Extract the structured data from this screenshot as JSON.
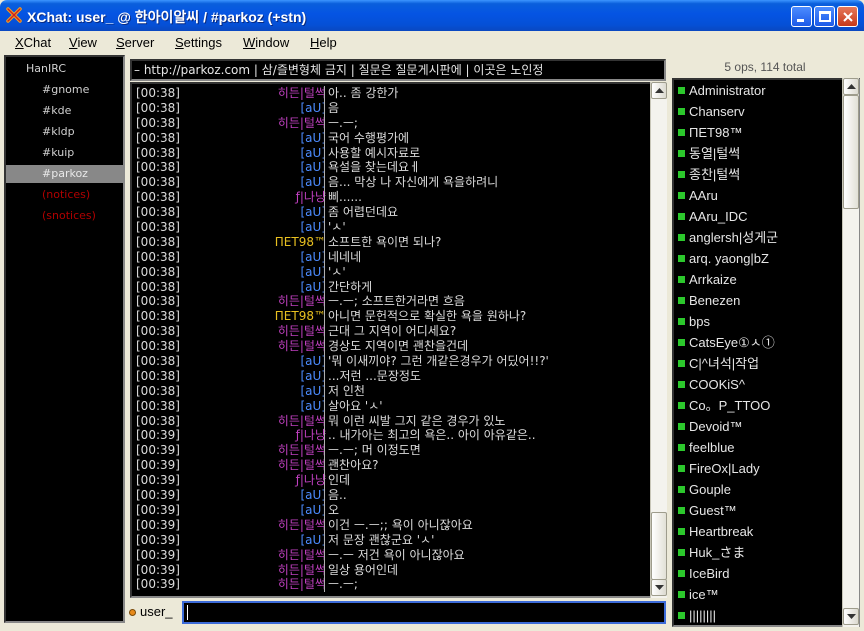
{
  "window": {
    "title": "XChat: user_ @ 한아이알씨 / #parkoz (+stn)"
  },
  "menu": [
    {
      "u": "X",
      "rest": "Chat"
    },
    {
      "u": "V",
      "rest": "iew"
    },
    {
      "u": "S",
      "rest": "erver"
    },
    {
      "u": "S",
      "rest": "ettings"
    },
    {
      "u": "W",
      "rest": "indow"
    },
    {
      "u": "H",
      "rest": "elp"
    }
  ],
  "tree": [
    {
      "label": "HanIRC",
      "type": "server"
    },
    {
      "label": "#gnome",
      "type": "channel"
    },
    {
      "label": "#kde",
      "type": "channel"
    },
    {
      "label": "#kldp",
      "type": "channel"
    },
    {
      "label": "#kuip",
      "type": "channel"
    },
    {
      "label": "#parkoz",
      "type": "selected"
    },
    {
      "label": "(notices)",
      "type": "notice"
    },
    {
      "label": "(snotices)",
      "type": "notice"
    }
  ],
  "topic": "– http://parkoz.com | 삼/즐변형체 금지 | 질문은 질문게시판에 | 이곳은 노인정",
  "colors": {
    "nick_hiden": "#c040c0",
    "nick_au": "#4c8cff",
    "nick_pet": "#e8c020",
    "nick_nayang": "#c040c0",
    "accent": "#0554e3"
  },
  "chat": [
    {
      "ts": "[00:38]",
      "nick": "히든|털썩",
      "color": "#c040c0",
      "msg": "아.. 좀 강한가"
    },
    {
      "ts": "[00:38]",
      "nick": "[aU]",
      "color": "#4c8cff",
      "msg": "음"
    },
    {
      "ts": "[00:38]",
      "nick": "히든|털썩",
      "color": "#c040c0",
      "msg": "ㅡ.ㅡ;"
    },
    {
      "ts": "[00:38]",
      "nick": "[aU]",
      "color": "#4c8cff",
      "msg": "국어 수행평가에"
    },
    {
      "ts": "[00:38]",
      "nick": "[aU]",
      "color": "#4c8cff",
      "msg": "사용할 예시자료로"
    },
    {
      "ts": "[00:38]",
      "nick": "[aU]",
      "color": "#4c8cff",
      "msg": "욕설을 찾는데요ㅔ"
    },
    {
      "ts": "[00:38]",
      "nick": "[aU]",
      "color": "#4c8cff",
      "msg": "음... 막상 나 자신에게 욕을하려니"
    },
    {
      "ts": "[00:38]",
      "nick": "ƒ|나냥",
      "color": "#c040c0",
      "msg": "삐......"
    },
    {
      "ts": "[00:38]",
      "nick": "[aU]",
      "color": "#4c8cff",
      "msg": "좀 어렵던데요"
    },
    {
      "ts": "[00:38]",
      "nick": "[aU]",
      "color": "#4c8cff",
      "msg": "'ㅅ'"
    },
    {
      "ts": "[00:38]",
      "nick": "ΠΕΤ98™",
      "color": "#e8c020",
      "msg": "소프트한 욕이면 되나?"
    },
    {
      "ts": "[00:38]",
      "nick": "[aU]",
      "color": "#4c8cff",
      "msg": "네네네"
    },
    {
      "ts": "[00:38]",
      "nick": "[aU]",
      "color": "#4c8cff",
      "msg": "'ㅅ'"
    },
    {
      "ts": "[00:38]",
      "nick": "[aU]",
      "color": "#4c8cff",
      "msg": "간단하게"
    },
    {
      "ts": "[00:38]",
      "nick": "히든|털썩",
      "color": "#c040c0",
      "msg": "ㅡ.ㅡ; 소프트한거라면 흐음"
    },
    {
      "ts": "[00:38]",
      "nick": "ΠΕΤ98™",
      "color": "#e8c020",
      "msg": "아니면 문헌적으로 확실한 욕을 원하나?"
    },
    {
      "ts": "[00:38]",
      "nick": "히든|털썩",
      "color": "#c040c0",
      "msg": "근대 그 지역이 어디세요?"
    },
    {
      "ts": "[00:38]",
      "nick": "히든|털썩",
      "color": "#c040c0",
      "msg": "경상도 지역이면 괜찬을건데"
    },
    {
      "ts": "[00:38]",
      "nick": "[aU]",
      "color": "#4c8cff",
      "msg": "'뭐 이새끼야? 그런 개같은경우가 어딨어!!?'"
    },
    {
      "ts": "[00:38]",
      "nick": "[aU]",
      "color": "#4c8cff",
      "msg": "...저런 ...문장정도"
    },
    {
      "ts": "[00:38]",
      "nick": "[aU]",
      "color": "#4c8cff",
      "msg": "저 인천"
    },
    {
      "ts": "[00:38]",
      "nick": "[aU]",
      "color": "#4c8cff",
      "msg": "살아요 'ㅅ'"
    },
    {
      "ts": "[00:38]",
      "nick": "히든|털썩",
      "color": "#c040c0",
      "msg": "뭐 이런 씨발 그지 같은 경우가 있노"
    },
    {
      "ts": "[00:39]",
      "nick": "ƒ|나냥",
      "color": "#c040c0",
      "msg": ".. 내가아는 최고의 욕은.. 아이 아유같은.."
    },
    {
      "ts": "[00:39]",
      "nick": "히든|털썩",
      "color": "#c040c0",
      "msg": "ㅡ.ㅡ; 머 이정도면"
    },
    {
      "ts": "[00:39]",
      "nick": "히든|털썩",
      "color": "#c040c0",
      "msg": "괜찬아요?"
    },
    {
      "ts": "[00:39]",
      "nick": "ƒ|나냥",
      "color": "#c040c0",
      "msg": "인데"
    },
    {
      "ts": "[00:39]",
      "nick": "[aU]",
      "color": "#4c8cff",
      "msg": "음.."
    },
    {
      "ts": "[00:39]",
      "nick": "[aU]",
      "color": "#4c8cff",
      "msg": "오"
    },
    {
      "ts": "[00:39]",
      "nick": "히든|털썩",
      "color": "#c040c0",
      "msg": "이건 ㅡ.ㅡ;; 욕이 아니잖아요"
    },
    {
      "ts": "[00:39]",
      "nick": "[aU]",
      "color": "#4c8cff",
      "msg": "저 문장 괜찮군요 'ㅅ'"
    },
    {
      "ts": "[00:39]",
      "nick": "히든|털썩",
      "color": "#c040c0",
      "msg": "ㅡ.ㅡ 저건 욕이 아니잖아요"
    },
    {
      "ts": "[00:39]",
      "nick": "히든|털썩",
      "color": "#c040c0",
      "msg": "일상 용어인데"
    },
    {
      "ts": "[00:39]",
      "nick": "히든|털썩",
      "color": "#c040c0",
      "msg": "ㅡ.ㅡ;"
    }
  ],
  "input": {
    "nick": "user_",
    "value": ""
  },
  "userlist": {
    "summary": "5 ops, 114 total",
    "users": [
      "Administrator",
      "Chanserv",
      "ΠΕΤ98™",
      "동열|털썩",
      "종찬|털썩",
      "AAru",
      "AAru_IDC",
      "anglersh|성게군",
      "arq. yaong|bZ",
      "Arrkaize",
      "Benezen",
      "bps",
      "CatsEye①ㅅ①",
      "C|^녀석|작업",
      "COOKiS^",
      "Co。P_TTOO",
      "Devoid™",
      "feelblue",
      "FireOx|Lady",
      "Gouple",
      "Guest™",
      "Heartbreak",
      "Huk_さま",
      "IceBird",
      "ice™",
      "||||||||"
    ]
  }
}
